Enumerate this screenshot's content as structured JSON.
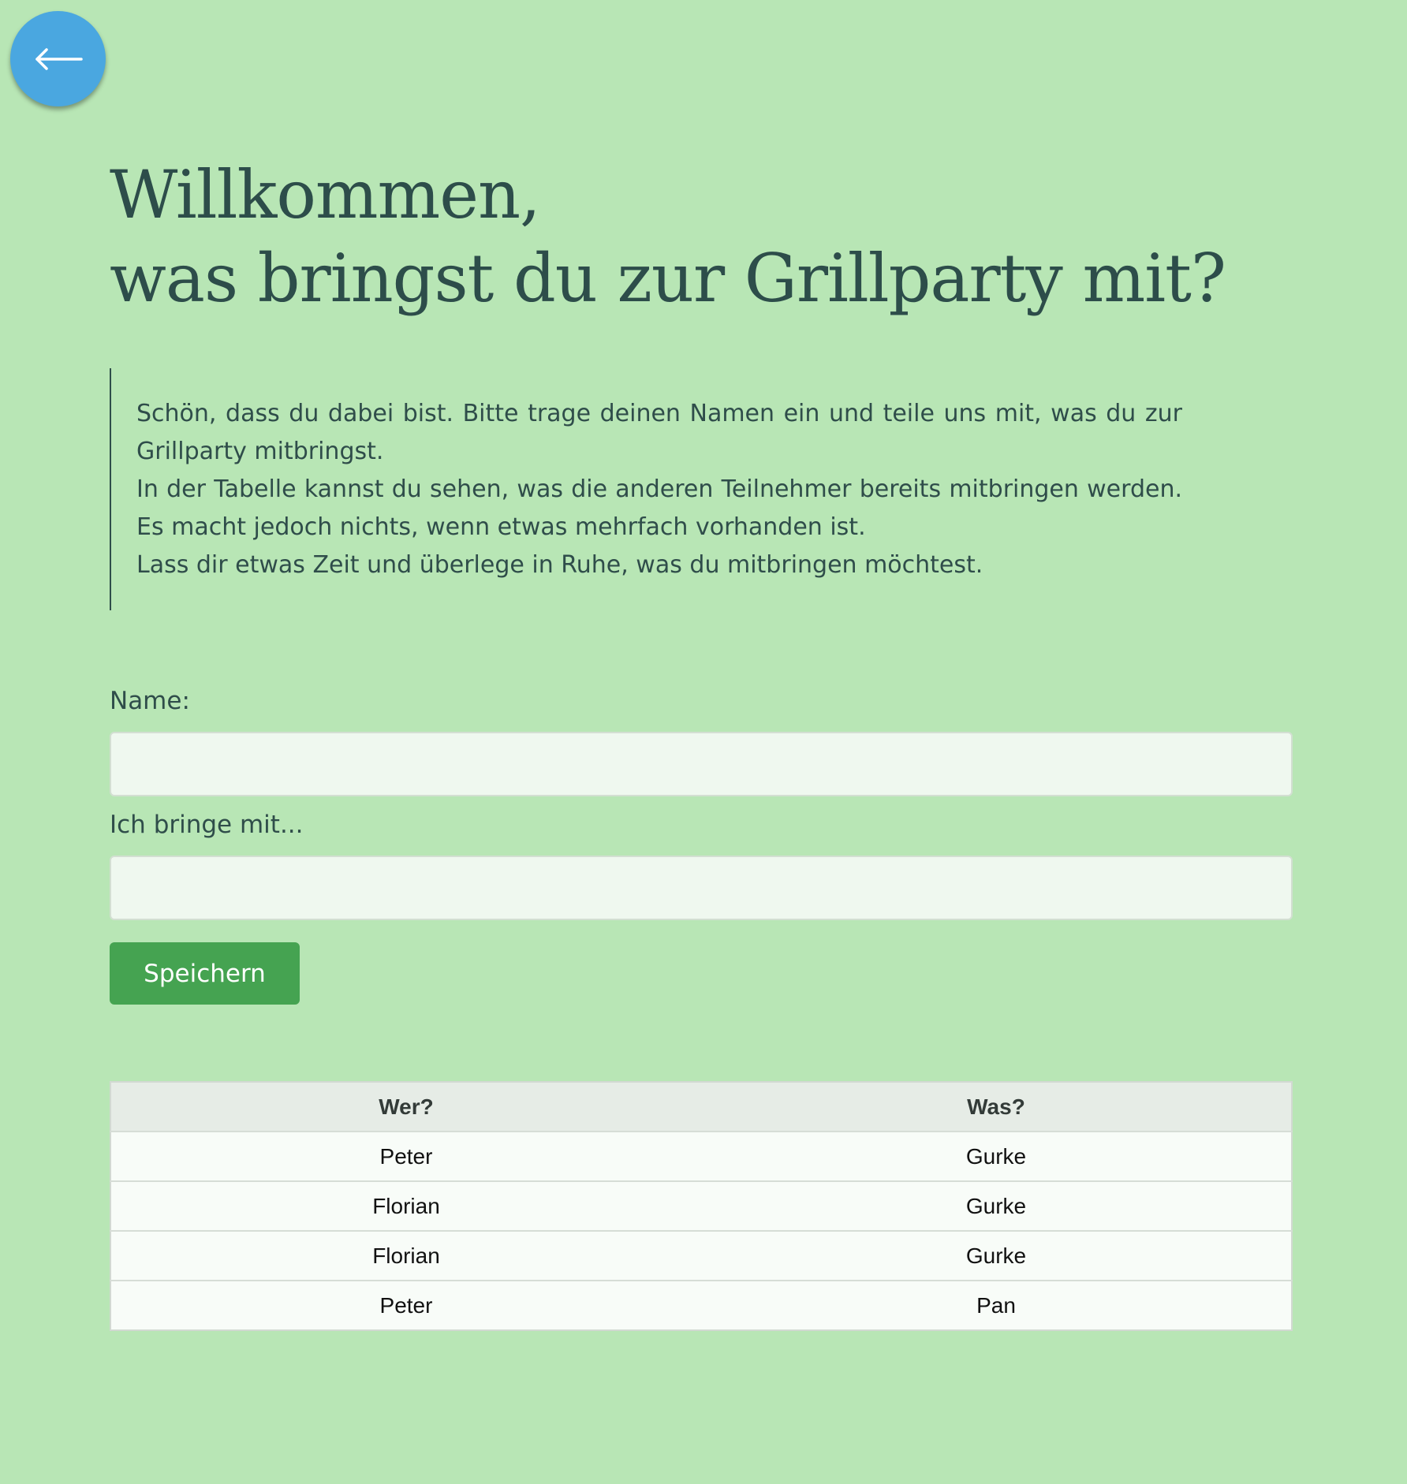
{
  "navigation": {
    "back_icon": "left-arrow-icon",
    "back_button_color": "#4aa7e0"
  },
  "header": {
    "title_line1": "Willkommen,",
    "title_line2": "was bringst du zur Grillparty mit?"
  },
  "intro": {
    "paragraph1": "Schön, dass du dabei bist. Bitte trage deinen Namen ein und teile uns mit, was du zur Grillparty mitbringst.",
    "paragraph2": "In der Tabelle kannst du sehen, was die anderen Teilnehmer bereits mitbringen werden. Es macht jedoch nichts, wenn etwas mehrfach vorhanden ist.",
    "paragraph3": "Lass dir etwas Zeit und überlege in Ruhe, was du mitbringen möchtest."
  },
  "form": {
    "name_label": "Name:",
    "name_value": "",
    "item_label": "Ich bringe mit...",
    "item_value": "",
    "save_label": "Speichern",
    "save_color": "#45a351"
  },
  "table": {
    "headers": [
      "Wer?",
      "Was?"
    ],
    "rows": [
      {
        "who": "Peter",
        "what": "Gurke"
      },
      {
        "who": "Florian",
        "what": "Gurke"
      },
      {
        "who": "Florian",
        "what": "Gurke"
      },
      {
        "who": "Peter",
        "what": "Pan"
      }
    ]
  },
  "theme": {
    "background": "#b8e6b5",
    "text": "#2f4d4a"
  }
}
